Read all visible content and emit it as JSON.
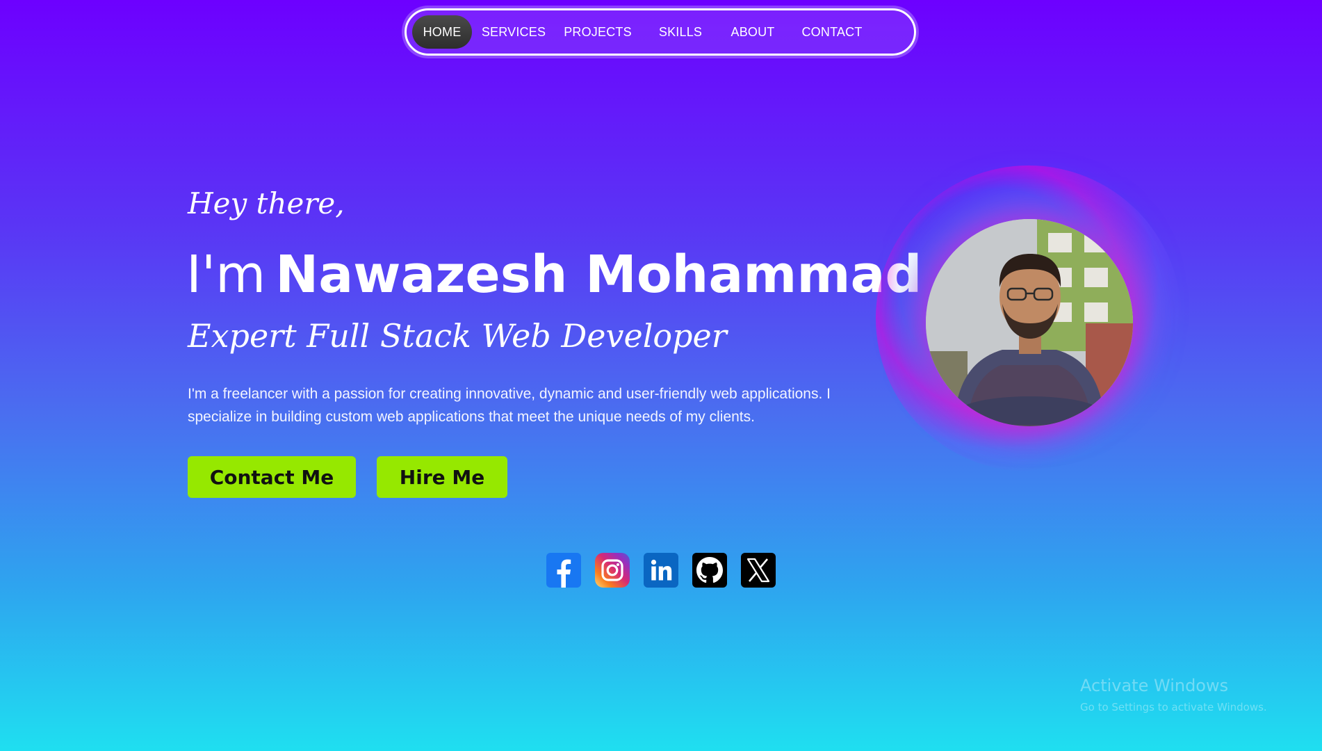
{
  "nav": {
    "items": [
      {
        "label": "HOME",
        "active": true
      },
      {
        "label": "SERVICES",
        "active": false
      },
      {
        "label": "PROJECTS",
        "active": false
      },
      {
        "label": "SKILLS",
        "active": false
      },
      {
        "label": "ABOUT",
        "active": false
      },
      {
        "label": "CONTACT",
        "active": false
      }
    ]
  },
  "hero": {
    "greeting": "Hey there,",
    "intro": "I'm",
    "name": "Nawazesh Mohammad",
    "tagline": "Expert Full Stack Web Developer",
    "bio": "I'm a freelancer with a passion for creating innovative, dynamic and user-friendly web applications. I specialize in building custom web applications that meet the unique needs of my clients."
  },
  "buttons": {
    "contact": "Contact Me",
    "hire": "Hire Me"
  },
  "socials": [
    {
      "icon": "facebook-icon"
    },
    {
      "icon": "instagram-icon"
    },
    {
      "icon": "linkedin-icon"
    },
    {
      "icon": "github-icon"
    },
    {
      "icon": "x-icon"
    }
  ],
  "colors": {
    "accent_button": "#96e800",
    "gradient_top": "#6d00ff",
    "gradient_bottom": "#1fdff0",
    "nav_active": "#3a3a3a"
  },
  "watermark": {
    "title": "Activate Windows",
    "subtitle": "Go to Settings to activate Windows."
  }
}
